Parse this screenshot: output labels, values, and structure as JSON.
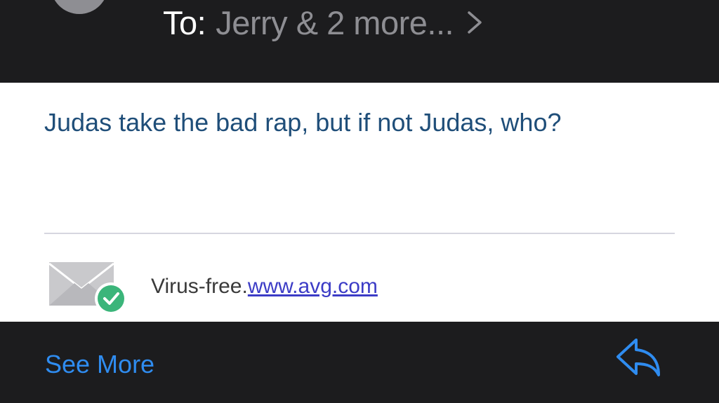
{
  "header": {
    "to_label": "To:",
    "recipients": "Jerry & 2 more..."
  },
  "message": {
    "body_text": "Judas take the bad rap, but if not Judas, who?"
  },
  "signature": {
    "prefix": "Virus-free.",
    "link_text": "www.avg.com"
  },
  "footer": {
    "see_more_label": "See More"
  },
  "colors": {
    "dark_background": "#1c1c1e",
    "message_text": "#1f4e79",
    "accent_blue": "#2f8cf0",
    "link": "#3c3cc6",
    "badge_green": "#3bb57a"
  }
}
